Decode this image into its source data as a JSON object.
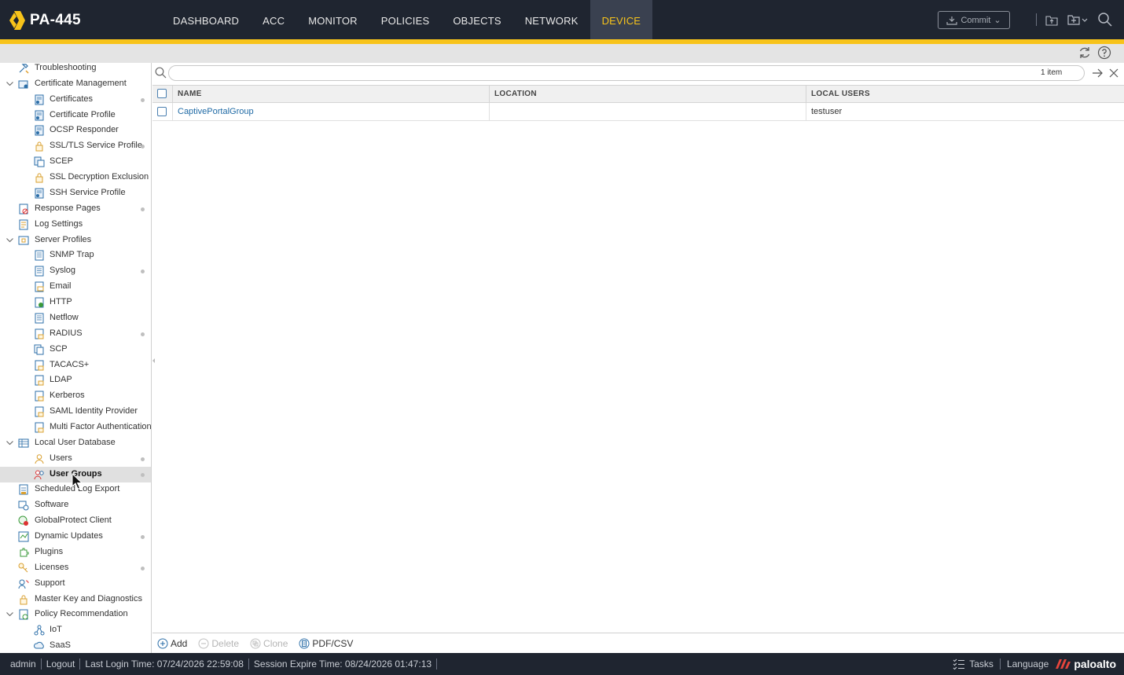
{
  "app": {
    "device_name": "PA-445"
  },
  "nav": {
    "tabs": [
      {
        "label": "DASHBOARD",
        "active": false
      },
      {
        "label": "ACC",
        "active": false
      },
      {
        "label": "MONITOR",
        "active": false
      },
      {
        "label": "POLICIES",
        "active": false
      },
      {
        "label": "OBJECTS",
        "active": false
      },
      {
        "label": "NETWORK",
        "active": false
      },
      {
        "label": "DEVICE",
        "active": true
      }
    ],
    "commit_label": "Commit"
  },
  "sidebar": {
    "items": [
      {
        "label": "Troubleshooting",
        "level": 1,
        "icon": "tools-icon",
        "dot": false
      },
      {
        "label": "Certificate Management",
        "level": 1,
        "icon": "certificate-folder-icon",
        "expanded": true,
        "dot": false
      },
      {
        "label": "Certificates",
        "level": 2,
        "icon": "certificate-icon",
        "dot": true
      },
      {
        "label": "Certificate Profile",
        "level": 2,
        "icon": "certificate-icon",
        "dot": false
      },
      {
        "label": "OCSP Responder",
        "level": 2,
        "icon": "certificate-icon",
        "dot": false
      },
      {
        "label": "SSL/TLS Service Profile",
        "level": 2,
        "icon": "lock-icon",
        "dot": true
      },
      {
        "label": "SCEP",
        "level": 2,
        "icon": "scep-icon",
        "dot": false
      },
      {
        "label": "SSL Decryption Exclusion",
        "level": 2,
        "icon": "lock-icon",
        "dot": false
      },
      {
        "label": "SSH Service Profile",
        "level": 2,
        "icon": "certificate-icon",
        "dot": false
      },
      {
        "label": "Response Pages",
        "level": 1,
        "icon": "response-pages-icon",
        "dot": true
      },
      {
        "label": "Log Settings",
        "level": 1,
        "icon": "log-settings-icon",
        "dot": false
      },
      {
        "label": "Server Profiles",
        "level": 1,
        "icon": "server-profiles-icon",
        "expanded": true,
        "dot": false
      },
      {
        "label": "SNMP Trap",
        "level": 2,
        "icon": "document-icon",
        "dot": false
      },
      {
        "label": "Syslog",
        "level": 2,
        "icon": "document-icon",
        "dot": true
      },
      {
        "label": "Email",
        "level": 2,
        "icon": "email-icon",
        "dot": false
      },
      {
        "label": "HTTP",
        "level": 2,
        "icon": "http-icon",
        "dot": false
      },
      {
        "label": "Netflow",
        "level": 2,
        "icon": "document-icon",
        "dot": false
      },
      {
        "label": "RADIUS",
        "level": 2,
        "icon": "lock-document-icon",
        "dot": true
      },
      {
        "label": "SCP",
        "level": 2,
        "icon": "copy-icon",
        "dot": false
      },
      {
        "label": "TACACS+",
        "level": 2,
        "icon": "lock-document-icon",
        "dot": false
      },
      {
        "label": "LDAP",
        "level": 2,
        "icon": "lock-document-icon",
        "dot": false
      },
      {
        "label": "Kerberos",
        "level": 2,
        "icon": "lock-document-icon",
        "dot": false
      },
      {
        "label": "SAML Identity Provider",
        "level": 2,
        "icon": "lock-document-icon",
        "dot": false
      },
      {
        "label": "Multi Factor Authentication",
        "level": 2,
        "icon": "lock-document-icon",
        "dot": false
      },
      {
        "label": "Local User Database",
        "level": 1,
        "icon": "database-icon",
        "expanded": true,
        "dot": false
      },
      {
        "label": "Users",
        "level": 2,
        "icon": "user-icon",
        "dot": true
      },
      {
        "label": "User Groups",
        "level": 2,
        "icon": "user-group-icon",
        "dot": true,
        "selected": true
      },
      {
        "label": "Scheduled Log Export",
        "level": 1,
        "icon": "log-export-icon",
        "dot": false
      },
      {
        "label": "Software",
        "level": 1,
        "icon": "software-icon",
        "dot": false
      },
      {
        "label": "GlobalProtect Client",
        "level": 1,
        "icon": "globalprotect-icon",
        "dot": false
      },
      {
        "label": "Dynamic Updates",
        "level": 1,
        "icon": "dynamic-updates-icon",
        "dot": true
      },
      {
        "label": "Plugins",
        "level": 1,
        "icon": "plugin-icon",
        "dot": false
      },
      {
        "label": "Licenses",
        "level": 1,
        "icon": "key-icon",
        "dot": true
      },
      {
        "label": "Support",
        "level": 1,
        "icon": "support-icon",
        "dot": false
      },
      {
        "label": "Master Key and Diagnostics",
        "level": 1,
        "icon": "master-key-icon",
        "dot": false
      },
      {
        "label": "Policy Recommendation",
        "level": 1,
        "icon": "policy-recommendation-icon",
        "expanded": true,
        "dot": false
      },
      {
        "label": "IoT",
        "level": 2,
        "icon": "iot-icon",
        "dot": false
      },
      {
        "label": "SaaS",
        "level": 2,
        "icon": "saas-icon",
        "dot": false
      }
    ]
  },
  "search": {
    "placeholder": "",
    "value": "",
    "count": "1 item"
  },
  "table": {
    "columns": [
      "NAME",
      "LOCATION",
      "LOCAL USERS"
    ],
    "rows": [
      {
        "name": "CaptivePortalGroup",
        "location": "",
        "local_users": "testuser"
      }
    ]
  },
  "actions": {
    "add": "Add",
    "delete": "Delete",
    "clone": "Clone",
    "pdfcsv": "PDF/CSV"
  },
  "status": {
    "user": "admin",
    "logout": "Logout",
    "last_login": "Last Login Time: 07/24/2026 22:59:08",
    "session_expire": "Session Expire Time: 08/24/2026 01:47:13",
    "tasks": "Tasks",
    "language": "Language",
    "brand": "paloalto"
  },
  "colors": {
    "accent": "#f7c31a",
    "topbar": "#1f2530",
    "link": "#1f6aa5"
  }
}
